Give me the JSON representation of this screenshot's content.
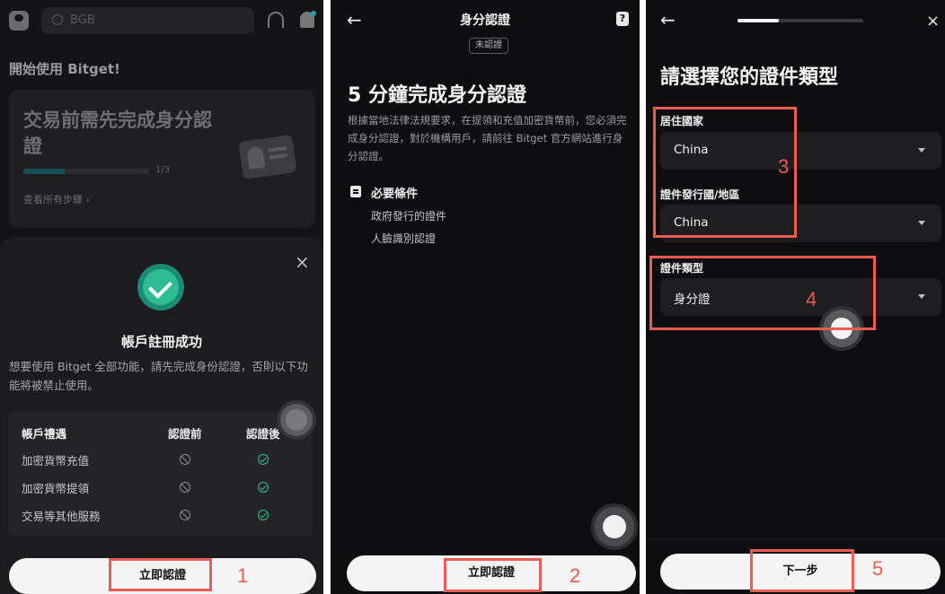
{
  "panel1": {
    "search_placeholder": "BGB",
    "welcome_title": "開始使用 Bitget!",
    "card": {
      "title": "交易前需先完成身分認證",
      "progress_text": "1/3",
      "progress_fraction": 0.33,
      "steps_link": "查看所有步驟 ›"
    },
    "sheet": {
      "close": "×",
      "title": "帳戶註冊成功",
      "description": "想要使用 Bitget 全部功能，請先完成身份認證，否則以下功能將被禁止使用。",
      "table_headers": [
        "帳戶禮遇",
        "認證前",
        "認證後"
      ],
      "table_rows": [
        "加密貨幣充值",
        "加密貨幣提領",
        "交易等其他服務"
      ]
    },
    "button_label": "立即認證",
    "annotation_number": "1"
  },
  "panel2": {
    "back": "←",
    "title": "身分認證",
    "status_badge": "未認證",
    "help_icon": "?",
    "heading": "5 分鐘完成身分認證",
    "description": "根據當地法律法規要求，在提領和充值加密貨幣前，您必須完成身分認證，對於機構用戶，請前往 Bitget 官方網站進行身分認證。",
    "requirements_title": "必要條件",
    "requirements": [
      "政府發行的證件",
      "人臉識別認證"
    ],
    "button_label": "立即認證",
    "annotation_number": "2"
  },
  "panel3": {
    "back": "←",
    "close": "×",
    "step_progress_fraction": 0.33,
    "heading": "請選擇您的證件類型",
    "fields": [
      {
        "label": "居住國家",
        "value": "China"
      },
      {
        "label": "證件發行國/地區",
        "value": "China"
      },
      {
        "label": "證件類型",
        "value": "身分證"
      }
    ],
    "button_label": "下一步",
    "annotation_numbers": [
      "3",
      "4",
      "5"
    ]
  },
  "colors": {
    "accent_green": "#2ebd92",
    "annotation_red": "#ec5b54",
    "background_dark": "#0e0e10"
  }
}
